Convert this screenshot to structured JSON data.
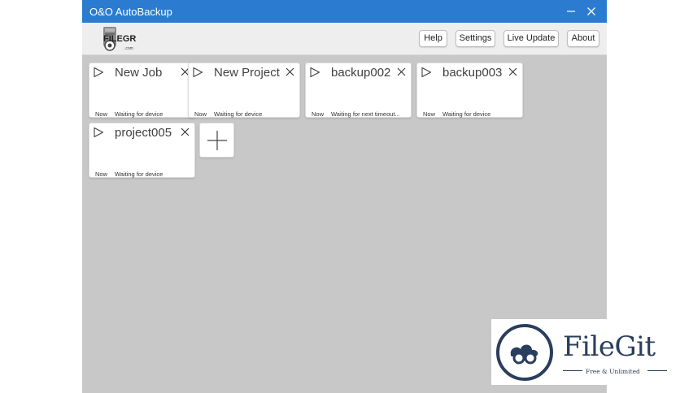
{
  "window": {
    "title": "O&O AutoBackup"
  },
  "toolbar": {
    "logo_text": "FILEGR",
    "logo_sub": ".com",
    "buttons": {
      "help": "Help",
      "settings": "Settings",
      "live_update": "Live Update",
      "about": "About"
    }
  },
  "jobs": [
    {
      "name": "New Job",
      "when": "Now",
      "status": "Waiting for device"
    },
    {
      "name": "New Project",
      "when": "Now",
      "status": "Waiting for device"
    },
    {
      "name": "backup002",
      "when": "Now",
      "status": "Waiting for next timeout..."
    },
    {
      "name": "backup003",
      "when": "Now",
      "status": "Waiting for device"
    },
    {
      "name": "project005",
      "when": "Now",
      "status": "Waiting for device"
    }
  ],
  "watermark": {
    "name": "FileGit",
    "tagline": "Free & Unlimited"
  },
  "colors": {
    "titlebar": "#2b7bd1",
    "workspace": "#c8c8c8",
    "watermark": "#2a3e5d"
  },
  "icons": [
    "minimize-icon",
    "close-icon",
    "play-icon",
    "remove-job-icon",
    "add-job-icon"
  ]
}
